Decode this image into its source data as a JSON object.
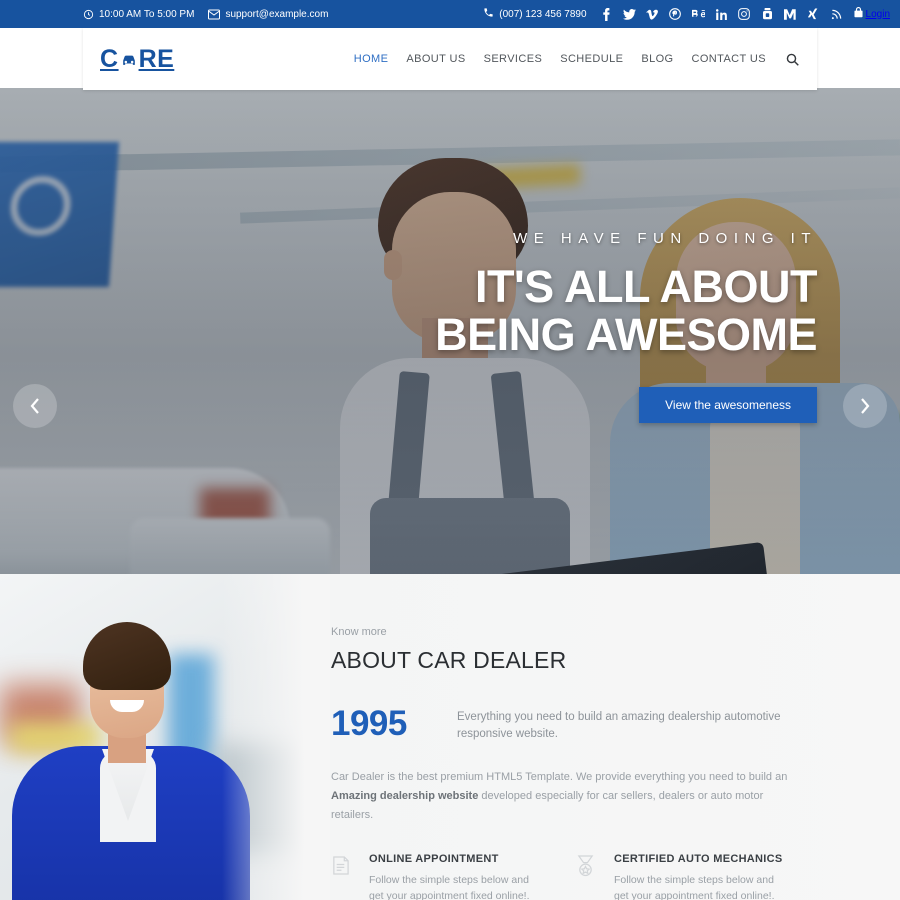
{
  "topbar": {
    "hours": "10:00 AM To 5:00 PM",
    "email": "support@example.com",
    "phone": "(007) 123 456 7890",
    "login_label": "Login",
    "social": [
      {
        "name": "facebook-icon",
        "label": "Facebook"
      },
      {
        "name": "twitter-icon",
        "label": "Twitter"
      },
      {
        "name": "vimeo-icon",
        "label": "Vimeo"
      },
      {
        "name": "pinterest-icon",
        "label": "Pinterest"
      },
      {
        "name": "behance-icon",
        "label": "Behance"
      },
      {
        "name": "linkedin-icon",
        "label": "LinkedIn"
      },
      {
        "name": "instagram-icon",
        "label": "Instagram"
      },
      {
        "name": "youtube-icon",
        "label": "YouTube"
      },
      {
        "name": "medium-icon",
        "label": "Medium"
      },
      {
        "name": "xing-icon",
        "label": "Xing"
      },
      {
        "name": "rss-icon",
        "label": "RSS"
      }
    ]
  },
  "header": {
    "logo_text_1": "C",
    "logo_text_2": "RE",
    "nav": [
      {
        "label": "HOME",
        "active": true
      },
      {
        "label": "ABOUT US",
        "active": false
      },
      {
        "label": "SERVICES",
        "active": false
      },
      {
        "label": "SCHEDULE",
        "active": false
      },
      {
        "label": "BLOG",
        "active": false
      },
      {
        "label": "CONTACT US",
        "active": false
      }
    ]
  },
  "hero": {
    "subtitle": "WE HAVE FUN DOING IT",
    "title": "IT'S ALL ABOUT BEING AWESOME",
    "button_label": "View the awesomeness",
    "prev_label": "Previous slide",
    "next_label": "Next slide"
  },
  "about": {
    "eyebrow": "Know more",
    "title": "ABOUT CAR DEALER",
    "year": "1995",
    "year_desc": "Everything you need to build an amazing dealership automotive responsive website.",
    "paragraph_1": "Car Dealer is the best premium HTML5 Template. We provide everything you need to build an ",
    "paragraph_bold": "Amazing dealership website",
    "paragraph_2": " developed especially for car sellers, dealers or auto motor retailers.",
    "features": [
      {
        "icon": "calendar-appointment-icon",
        "title": "ONLINE APPOINTMENT",
        "desc": "Follow the simple steps below and get your appointment fixed online!."
      },
      {
        "icon": "medal-award-icon",
        "title": "CERTIFIED AUTO MECHANICS",
        "desc": "Follow the simple steps below and get your appointment fixed online!."
      }
    ]
  },
  "colors": {
    "brand_blue": "#17539f",
    "accent_blue": "#1f5fb8",
    "nav_active": "#2f6fc4",
    "muted_text": "#9aa0a6"
  }
}
